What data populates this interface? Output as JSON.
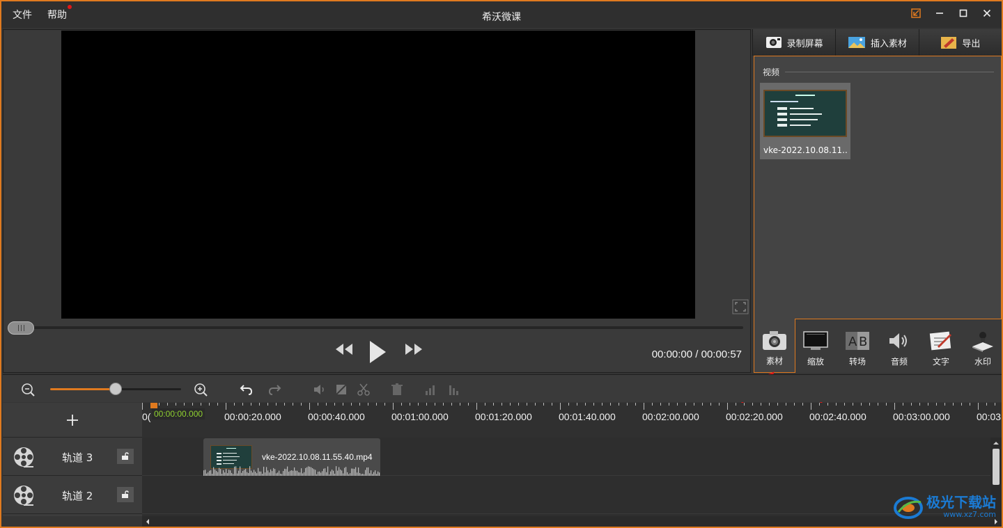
{
  "menu": {
    "file": "文件",
    "help": "帮助"
  },
  "window": {
    "title": "希沃微课"
  },
  "player": {
    "timecode": "00:00:00 / 00:00:57"
  },
  "toolbar": {
    "record": "录制屏幕",
    "insert": "插入素材",
    "export": "导出"
  },
  "media": {
    "section_label": "视频",
    "items": [
      {
        "name": "vke-2022.10.08.11...."
      }
    ]
  },
  "tabs": [
    {
      "label": "素材",
      "icon": "camera-icon",
      "active": true
    },
    {
      "label": "缩放",
      "icon": "monitor-icon"
    },
    {
      "label": "转场",
      "icon": "ab-transition-icon"
    },
    {
      "label": "音频",
      "icon": "speaker-icon"
    },
    {
      "label": "文字",
      "icon": "text-edit-icon"
    },
    {
      "label": "水印",
      "icon": "stamp-icon"
    }
  ],
  "zoom": {
    "level": 0.5
  },
  "timeline": {
    "current": "00:00:00.000",
    "start_stub": "0(",
    "ticks": [
      "00:00:20.000",
      "00:00:40.000",
      "00:01:00.000",
      "00:01:20.000",
      "00:01:40.000",
      "00:02:00.000",
      "00:02:20.000",
      "00:02:40.000",
      "00:03:00.000",
      "00:03"
    ],
    "tracks": [
      {
        "name": "轨道 3",
        "clip": "vke-2022.10.08.11.55.40.mp4"
      },
      {
        "name": "轨道 2",
        "clip": ""
      }
    ]
  },
  "watermark": {
    "brand": "极光下载站",
    "url": "www.xz7.com"
  },
  "colors": {
    "accent": "#e07a1f",
    "timecode_green": "#8fd130",
    "arrow": "#e01818"
  }
}
